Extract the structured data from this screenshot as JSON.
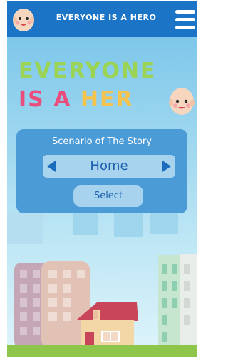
{
  "header": {
    "title": "EVERYONE IS A HERO",
    "menu_icon": "hamburger-menu-icon",
    "avatar_icon": "baby-avatar-icon"
  },
  "banner": {
    "line1": "EVERYONE",
    "line2_a": "IS A",
    "line2_b": "HER",
    "avatar_icon": "baby-avatar-icon"
  },
  "scenario": {
    "label": "Scenario of The Story",
    "value": "Home",
    "prev_icon": "arrow-left-icon",
    "next_icon": "arrow-right-icon",
    "select_label": "Select"
  },
  "colors": {
    "header_bg": "#1c74c6",
    "sky": "#86c8e6",
    "green": "#9bd455",
    "pink": "#ea4d7b",
    "yellow": "#f6c34d",
    "panel": "#4b9bd6"
  }
}
